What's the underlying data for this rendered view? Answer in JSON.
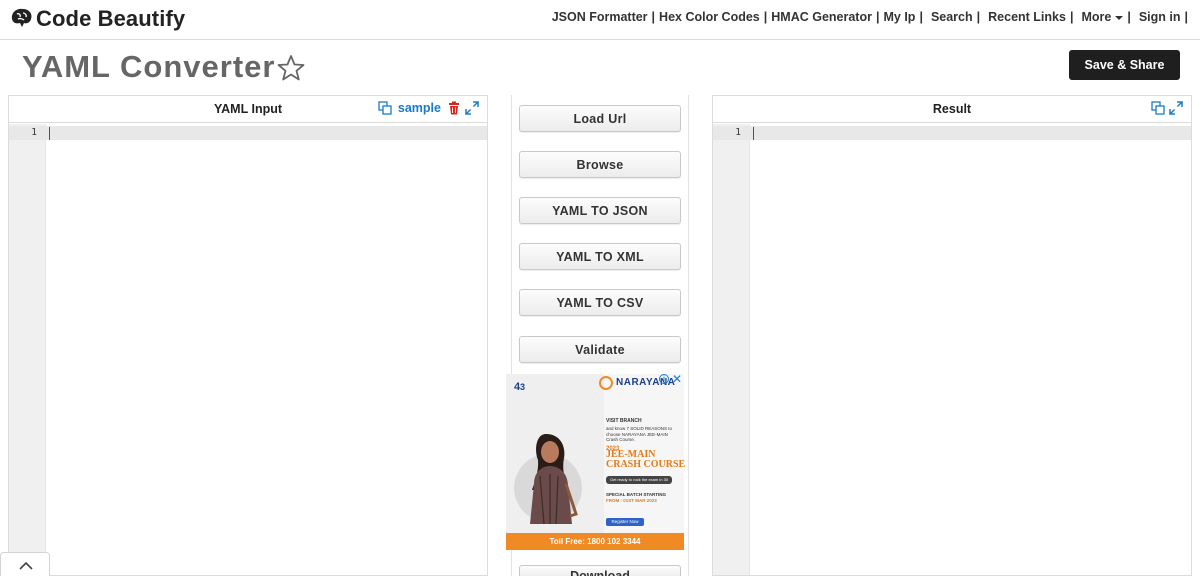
{
  "header": {
    "logo_text": "Code Beautify",
    "nav": [
      {
        "label": "JSON Formatter"
      },
      {
        "label": "Hex Color Codes"
      },
      {
        "label": "HMAC Generator"
      },
      {
        "label": "My Ip"
      },
      {
        "label": "Search"
      },
      {
        "label": "Recent Links"
      },
      {
        "label": "More"
      },
      {
        "label": "Sign in"
      }
    ]
  },
  "page": {
    "title": "YAML Converter",
    "save_share_label": "Save & Share"
  },
  "input_panel": {
    "title": "YAML Input",
    "sample_label": "sample",
    "line_number": "1",
    "value": ""
  },
  "result_panel": {
    "title": "Result",
    "line_number": "1",
    "value": ""
  },
  "actions": {
    "load_url": "Load Url",
    "browse": "Browse",
    "yaml_to_json": "YAML TO JSON",
    "yaml_to_xml": "YAML TO XML",
    "yaml_to_csv": "YAML TO CSV",
    "validate": "Validate",
    "download": "Download"
  },
  "ad": {
    "brand": "NARAYANA",
    "visit_branch": "VISIT BRANCH",
    "reason_text": "and know 7 SOLID REASONS to choose NARAYANA JEE-MAIN Crash Course.",
    "year": "2023",
    "headline_1": "JEE-MAIN",
    "headline_2": "CRASH COURSE",
    "pill_text": "Get ready to rock the exam in 30 days",
    "batch_text": "SPECIAL BATCH STARTING",
    "batch_date": "FROM : 01ST MAR 2023",
    "register": "Register Now",
    "toll_free": "Toll Free: 1800 102 3344",
    "accent_color": "#f08a24"
  },
  "colors": {
    "link_blue": "#1a7bc9",
    "delete_red": "#d9251d",
    "dark_button": "#1f1f1f",
    "title_gray": "#666666"
  }
}
